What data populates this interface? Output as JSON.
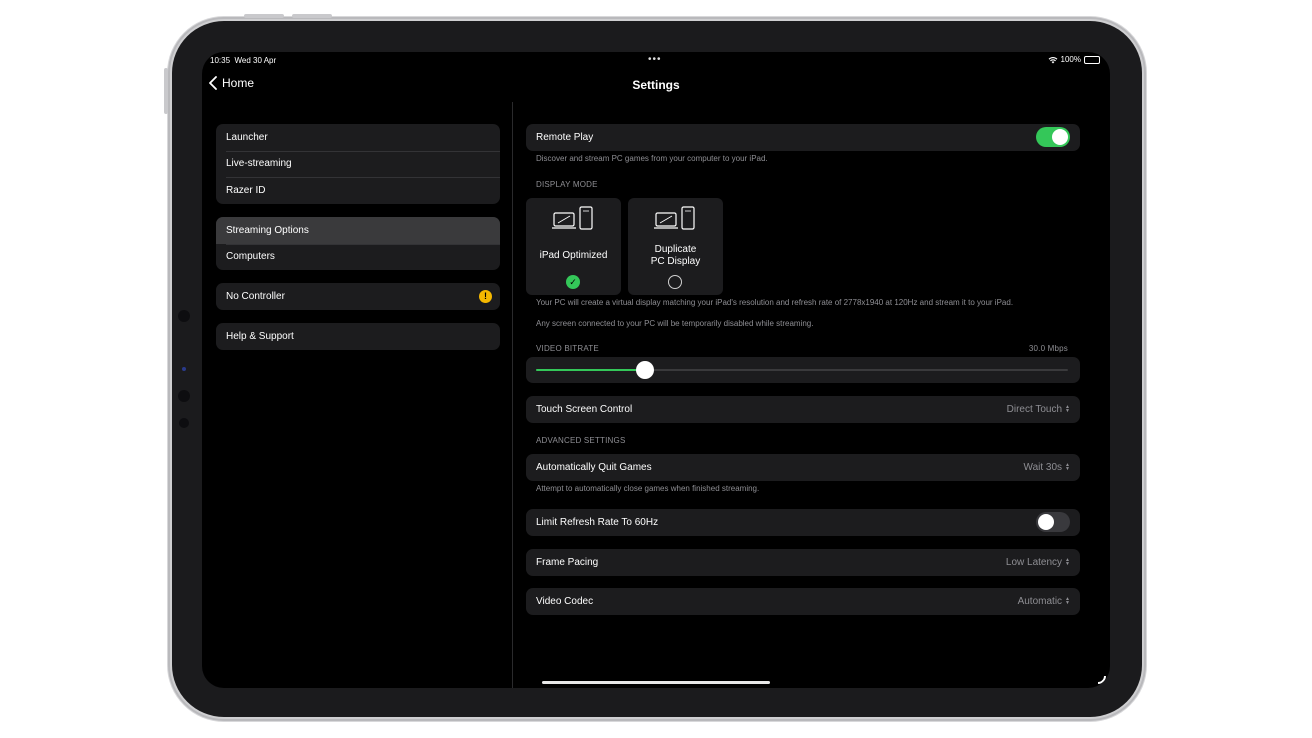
{
  "status_bar": {
    "time": "10:35",
    "date": "Wed 30 Apr",
    "dots": "•••",
    "battery": "100%"
  },
  "nav": {
    "back_label": "Home",
    "title": "Settings"
  },
  "sidebar": {
    "group1": [
      "Launcher",
      "Live-streaming",
      "Razer ID"
    ],
    "group2": [
      "Streaming Options",
      "Computers"
    ],
    "group3": [
      "No Controller"
    ],
    "group4": [
      "Help & Support"
    ],
    "selected": "Streaming Options",
    "warning_glyph": "!"
  },
  "remote_play": {
    "label": "Remote Play",
    "enabled": true,
    "description": "Discover and stream PC games from your computer to your iPad."
  },
  "display_mode": {
    "section_title": "DISPLAY MODE",
    "options": [
      {
        "label": "iPad Optimized",
        "selected": true
      },
      {
        "label_line1": "Duplicate",
        "label_line2": "PC Display",
        "selected": false
      }
    ],
    "note1": "Your PC will create a virtual display matching your iPad's resolution and refresh rate of 2778x1940 at 120Hz and stream it to your iPad.",
    "note2": "Any screen connected to your PC will be temporarily disabled while streaming."
  },
  "video_bitrate": {
    "section_title": "VIDEO BITRATE",
    "value_text": "30.0 Mbps",
    "fraction": 0.205
  },
  "touch_control": {
    "label": "Touch Screen Control",
    "value": "Direct Touch"
  },
  "advanced": {
    "section_title": "ADVANCED SETTINGS",
    "auto_quit": {
      "label": "Automatically Quit Games",
      "value": "Wait 30s",
      "description": "Attempt to automatically close games when finished streaming."
    },
    "limit_refresh": {
      "label": "Limit Refresh Rate To 60Hz",
      "enabled": false
    },
    "frame_pacing": {
      "label": "Frame Pacing",
      "value": "Low Latency"
    },
    "video_codec": {
      "label": "Video Codec",
      "value": "Automatic"
    }
  },
  "colors": {
    "accent_green": "#34c759",
    "warning": "#f5b800",
    "background": "#000000",
    "card": "#1c1c1e"
  }
}
